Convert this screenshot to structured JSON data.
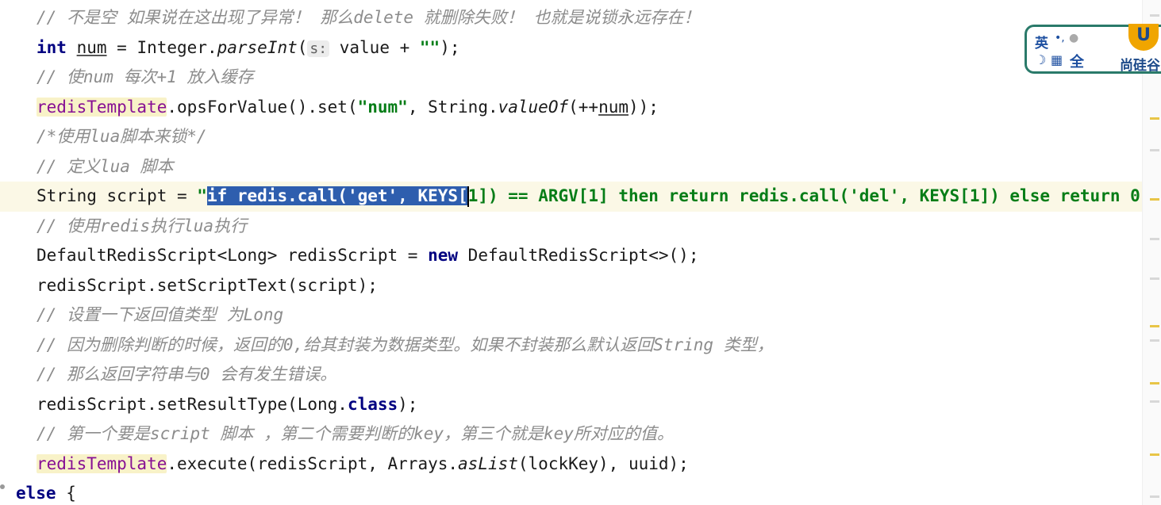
{
  "code_lines": {
    "l1": {
      "comment": "// 不是空 如果说在这出现了异常！ 那么delete 就删除失败！ 也就是说锁永远存在！"
    },
    "l2": {
      "kw_int": "int",
      "var_num": "num",
      "t1": " = Integer.",
      "method": "parseInt",
      "t2": "(",
      "hint": "s:",
      "t3": " value + ",
      "str": "\"\"",
      "t4": ");"
    },
    "l3": {
      "comment": "// 使num 每次+1 放入缓存"
    },
    "l4": {
      "field": "redisTemplate",
      "t1": ".opsForValue().set(",
      "str": "\"num\"",
      "t2": ", String.",
      "method": "valueOf",
      "t3": "(++",
      "var": "num",
      "t4": "));"
    },
    "l5": {
      "comment": "/*使用lua脚本来锁*/"
    },
    "l6": {
      "comment": "// 定义lua 脚本"
    },
    "l7": {
      "t1": "String script = ",
      "quote": "\"",
      "selected": "if redis.call('get', KEYS[",
      "rest": "1]) == ARGV[1] then return redis.call('del', KEYS[1]) else return 0"
    },
    "l8": {
      "comment": "// 使用redis执行lua执行"
    },
    "l9": {
      "t1": "DefaultRedisScript<Long> redisScript = ",
      "kw_new": "new",
      "t2": " DefaultRedisScript<>();"
    },
    "l10": {
      "t1": "redisScript.setScriptText(script);"
    },
    "l11": {
      "comment": "// 设置一下返回值类型 为Long"
    },
    "l12": {
      "comment": "// 因为删除判断的时候，返回的0,给其封装为数据类型。如果不封装那么默认返回String 类型，"
    },
    "l13": {
      "comment": "// 那么返回字符串与0 会有发生错误。"
    },
    "l14": {
      "t1": "redisScript.setResultType(Long.",
      "kw_class": "class",
      "t2": ");"
    },
    "l15": {
      "comment": "// 第一个要是script 脚本 ，第二个需要判断的key，第三个就是key所对应的值。"
    },
    "l16": {
      "field": "redisTemplate",
      "t1": ".execute(redisScript, Arrays.",
      "method": "asList",
      "t2": "(lockKey), uuid);"
    },
    "l17": {
      "kw_else": "else",
      "t1": " {"
    }
  },
  "ime_toolbar": {
    "lang": "英",
    "punct": "•,",
    "moon": "☽",
    "grid": "▦",
    "full": "全",
    "logo": "U",
    "brand": "尚硅谷"
  },
  "colors": {
    "comment": "#8c8c8c",
    "keyword": "#000080",
    "string": "#067d17",
    "field": "#871094",
    "selection": "#2e5eae"
  }
}
